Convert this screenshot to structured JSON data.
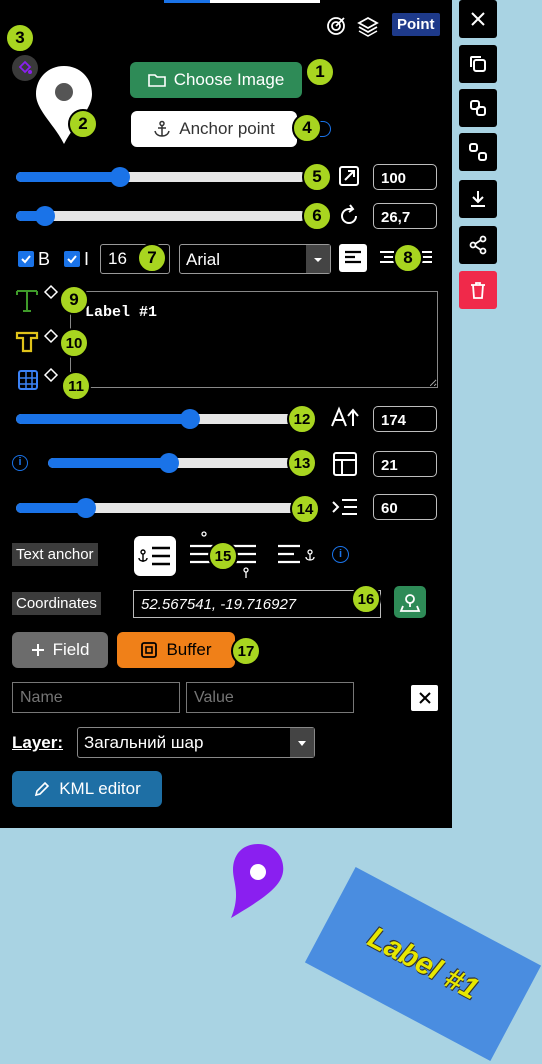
{
  "header": {
    "mode_badge": "Point",
    "target_icon": "target-icon",
    "layers_icon": "layers-icon"
  },
  "image_section": {
    "choose_image_label": "Choose Image",
    "anchor_point_label": "Anchor point"
  },
  "sliders": {
    "size": {
      "value_text": "100",
      "level": 0.36
    },
    "rotation": {
      "value_text": "26,7",
      "level": 0.1
    },
    "label_scale": {
      "value_text": "174",
      "level": 0.6
    },
    "width": {
      "value_text": "21",
      "level": 0.47
    },
    "spacing": {
      "value_text": "60",
      "level": 0.24
    }
  },
  "text_style": {
    "bold_label": "B",
    "italic_label": "I",
    "font_size": "16",
    "font_family": "Arial",
    "label_text": "Label #1"
  },
  "text_anchor": {
    "label": "Text anchor"
  },
  "coordinates": {
    "label": "Coordinates",
    "value": "52.567541, -19.716927"
  },
  "fields": {
    "add_field_label": "Field",
    "buffer_label": "Buffer",
    "name_placeholder": "Name",
    "value_placeholder": "Value"
  },
  "layer": {
    "label": "Layer:",
    "selected": "Загальний шар"
  },
  "kml_editor_label": "KML editor",
  "badges": [
    "1",
    "2",
    "3",
    "4",
    "5",
    "6",
    "7",
    "8",
    "9",
    "10",
    "11",
    "12",
    "13",
    "14",
    "15",
    "16",
    "17"
  ],
  "map": {
    "label_text": "Label #1",
    "marker_color": "#8a1ff0",
    "label_bg": "#4a8de0",
    "label_fg": "#e8e800"
  },
  "colors": {
    "accent": "#1a73e8",
    "green": "#2e8b57",
    "orange": "#f08018",
    "delete": "#f0294a"
  }
}
